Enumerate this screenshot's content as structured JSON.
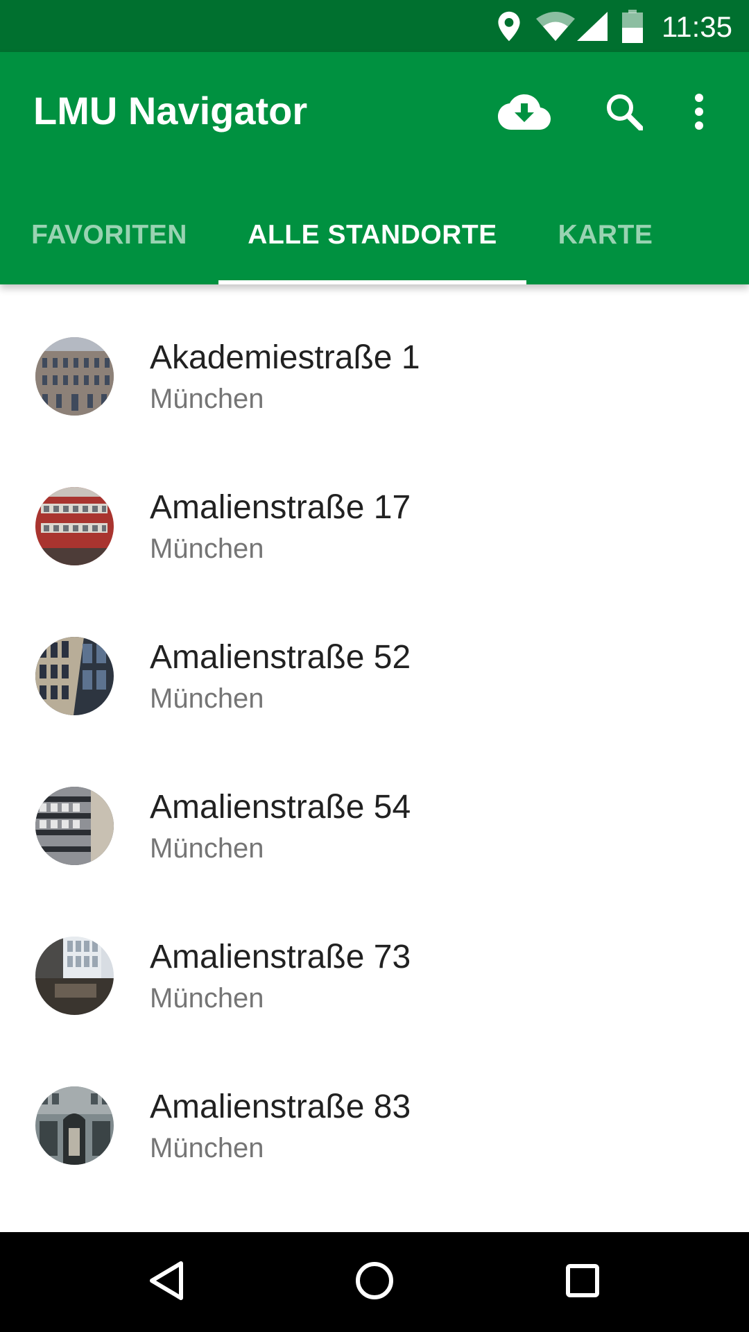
{
  "status_bar": {
    "time": "11:35",
    "icons": [
      "location-icon",
      "wifi-icon",
      "cell-signal-icon",
      "battery-icon"
    ]
  },
  "app_bar": {
    "title": "LMU Navigator",
    "actions": [
      "cloud-download-icon",
      "search-icon",
      "more-vert-icon"
    ],
    "color": "#009140",
    "status_color": "#00702f"
  },
  "tabs": [
    {
      "label": "FAVORITEN",
      "active": false
    },
    {
      "label": "ALLE STANDORTE",
      "active": true
    },
    {
      "label": "KARTE",
      "active": false
    }
  ],
  "locations": [
    {
      "title": "Akademiestraße 1",
      "city": "München"
    },
    {
      "title": "Amalienstraße 17",
      "city": "München"
    },
    {
      "title": "Amalienstraße 52",
      "city": "München"
    },
    {
      "title": "Amalienstraße 54",
      "city": "München"
    },
    {
      "title": "Amalienstraße 73",
      "city": "München"
    },
    {
      "title": "Amalienstraße 83",
      "city": "München"
    }
  ],
  "nav_bar": {
    "buttons": [
      "back-icon",
      "home-icon",
      "recents-icon"
    ]
  }
}
